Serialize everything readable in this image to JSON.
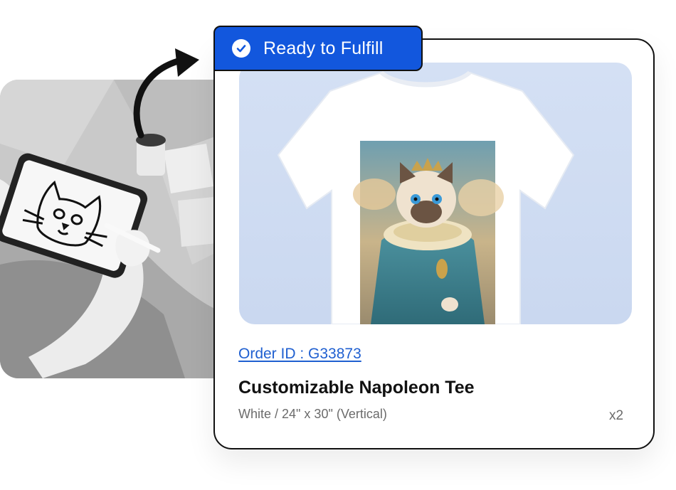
{
  "badge": {
    "label": "Ready to Fulfill",
    "icon": "check-circle-icon",
    "color": "#1257dd"
  },
  "order": {
    "id_label": "Order ID : G33873",
    "product_title": "Customizable Napoleon Tee",
    "variant": "White / 24\" x 30\" (Vertical)",
    "quantity": "x2"
  },
  "images": {
    "left_photo": "sketch-photo",
    "product": "tshirt-cat-portrait"
  },
  "colors": {
    "accent": "#1257dd",
    "link": "#1f5fd0",
    "product_bg": "#cad8f0"
  }
}
